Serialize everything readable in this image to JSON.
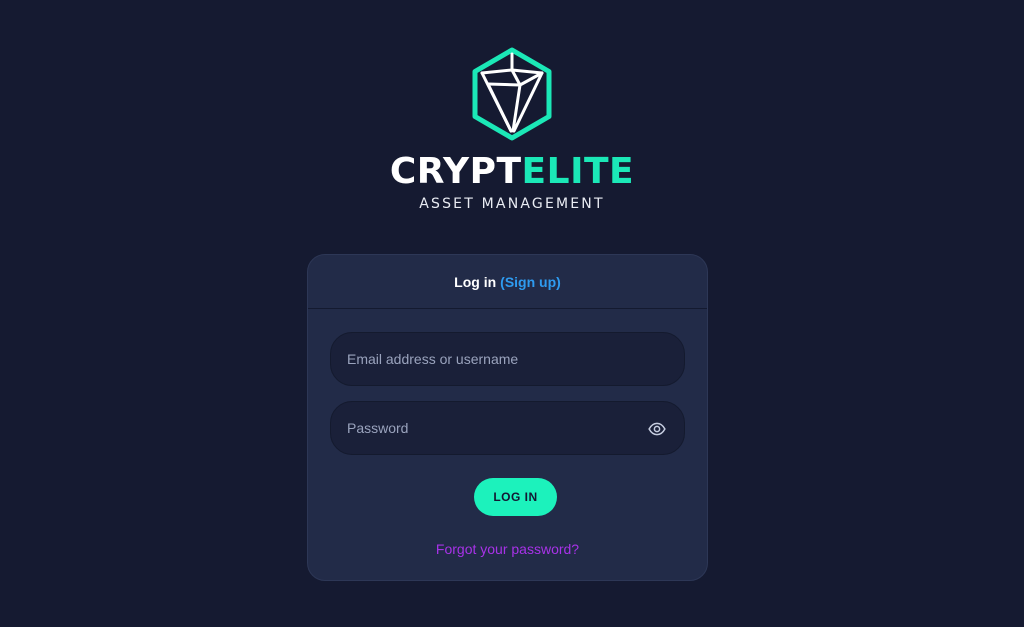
{
  "brand": {
    "name_part1": "CRYPT",
    "name_part2": "ELITE",
    "tagline": "ASSET MANAGEMENT",
    "icon": "hexagon-cube-logo-icon"
  },
  "login_card": {
    "title": "Log in",
    "signup_link": "(Sign up)",
    "email_field": {
      "placeholder": "Email address or username",
      "value": ""
    },
    "password_field": {
      "placeholder": "Password",
      "value": "",
      "toggle_icon": "eye-icon"
    },
    "login_button": "LOG IN",
    "forgot_password": "Forgot your password?"
  },
  "colors": {
    "background": "#151a31",
    "card": "#222b48",
    "accent": "#1cf2bc",
    "link": "#2e9bf0",
    "forgot_link": "#a832e8"
  }
}
